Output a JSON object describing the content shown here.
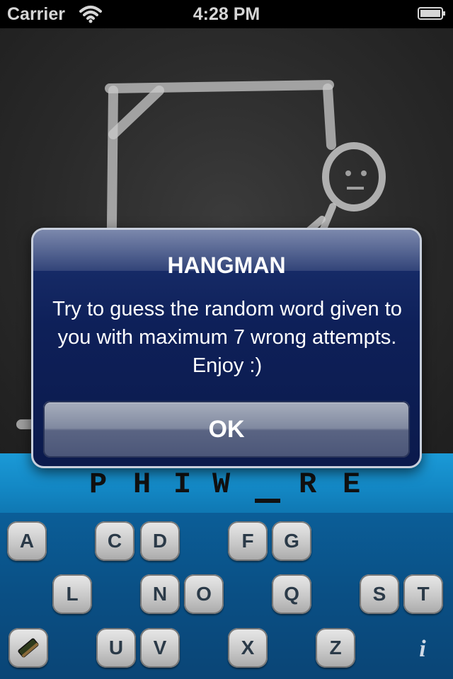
{
  "status_bar": {
    "carrier": "Carrier",
    "time": "4:28 PM"
  },
  "word": {
    "letters": [
      "P",
      "H",
      "I",
      "W",
      "",
      "R",
      "E"
    ]
  },
  "keyboard": {
    "keys": [
      "A",
      "C",
      "D",
      "F",
      "G",
      "L",
      "N",
      "O",
      "Q",
      "S",
      "T",
      "U",
      "V",
      "X",
      "Z"
    ]
  },
  "alert": {
    "title": "HANGMAN",
    "message": "Try to guess the random word given to you with maximum 7 wrong attempts. Enjoy :)",
    "ok_label": "OK"
  },
  "icons": {
    "erase": "eraser-icon",
    "info": "info-icon",
    "wifi": "wifi-icon",
    "battery": "battery-icon"
  }
}
